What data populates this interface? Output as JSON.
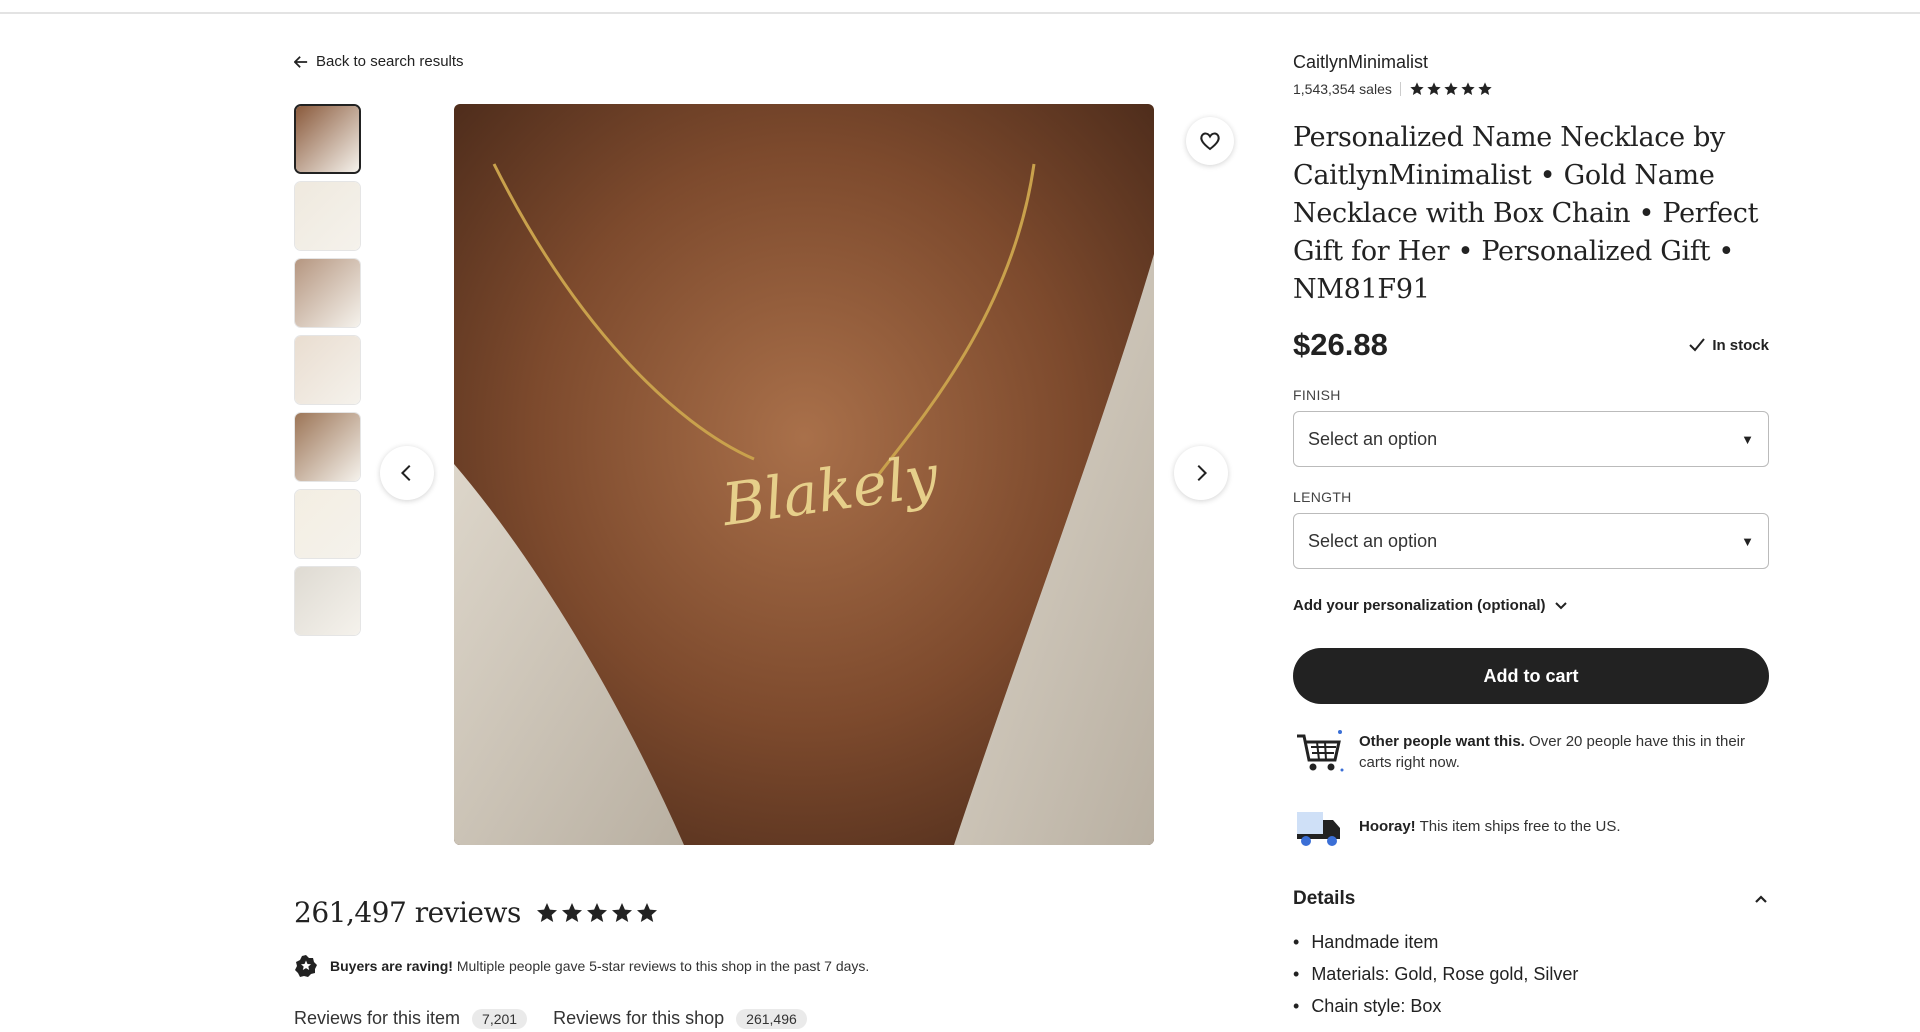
{
  "nav": {
    "back_label": "Back to search results"
  },
  "gallery": {
    "thumbnail_colors": [
      "#8a5a3c",
      "#efe9de",
      "#b59680",
      "#e9ddd0",
      "#9c7557",
      "#f3eee2",
      "#dedad2"
    ],
    "active_index": 0,
    "necklace_text": "Blakely"
  },
  "shop": {
    "name": "CaitlynMinimalist",
    "sales": "1,543,354 sales",
    "rating": 5
  },
  "product": {
    "title": "Personalized Name Necklace by CaitlynMinimalist • Gold Name Necklace with Box Chain • Perfect Gift for Her • Personalized Gift • NM81F91",
    "price": "$26.88",
    "stock": "In stock"
  },
  "options": {
    "finish_label": "FINISH",
    "finish_value": "Select an option",
    "length_label": "LENGTH",
    "length_value": "Select an option",
    "personalization_label": "Add your personalization (optional)"
  },
  "cart": {
    "button_label": "Add to cart"
  },
  "notices": {
    "demand_bold": "Other people want this.",
    "demand_text": " Over 20 people have this in their carts right now.",
    "shipping_bold": "Hooray!",
    "shipping_text": " This item ships free to the US."
  },
  "details": {
    "heading": "Details",
    "items": [
      "Handmade item",
      "Materials: Gold, Rose gold, Silver",
      "Chain style: Box"
    ]
  },
  "reviews": {
    "count_label": "261,497 reviews",
    "rating": 5,
    "raving_bold": "Buyers are raving!",
    "raving_text": " Multiple people gave 5-star reviews to this shop in the past 7 days.",
    "tab_item_label": "Reviews for this item",
    "tab_item_count": "7,201",
    "tab_shop_label": "Reviews for this shop",
    "tab_shop_count": "261,496"
  }
}
